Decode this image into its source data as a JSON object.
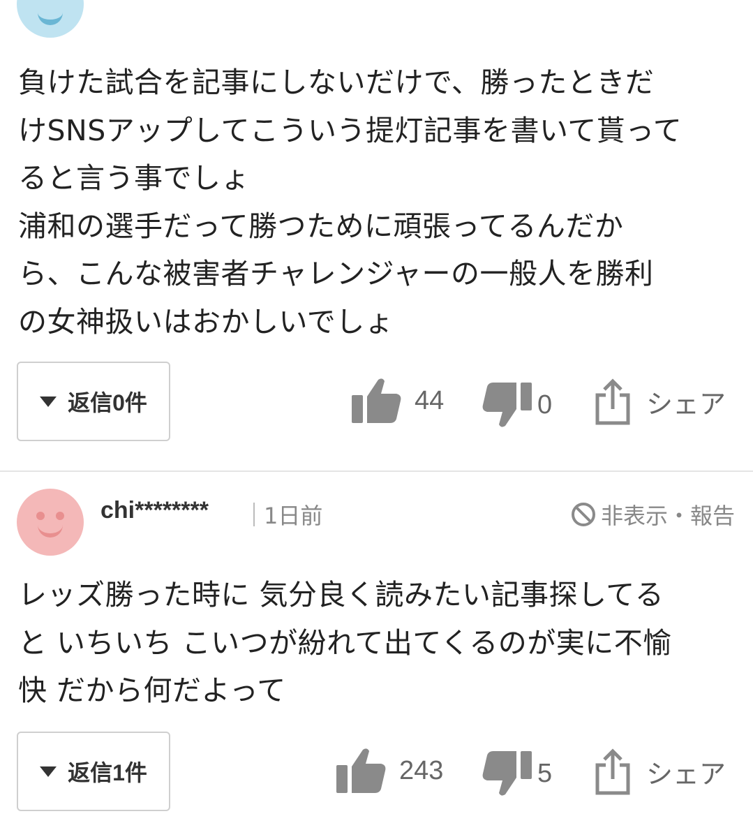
{
  "comment1": {
    "lines": [
      "負けた試合を記事にしないだけで、勝ったときだ",
      "けSNSアップしてこういう提灯記事を書いて貰って",
      "ると言う事でしょ",
      "浦和の選手だって勝つために頑張ってるんだか",
      "ら、こんな被害者チャレンジャーの一般人を勝利",
      "の女神扱いはおかしいでしょ"
    ],
    "reply_label": "返信0件",
    "likes": "44",
    "dislikes": "0",
    "share_label": "シェア"
  },
  "comment2": {
    "username": "chi********",
    "time": "1日前",
    "report_label": "非表示・報告",
    "lines": [
      "レッズ勝った時に 気分良く読みたい記事探してる",
      "と いちいち こいつが紛れて出てくるのが実に不愉",
      "快  だから何だよって"
    ],
    "reply_label": "返信1件",
    "likes": "243",
    "dislikes": "5",
    "share_label": "シェア"
  },
  "icons": {
    "like": "thumbs-up-icon",
    "dislike": "thumbs-down-icon",
    "share": "share-icon",
    "report": "block-icon",
    "expand": "triangle-down-icon"
  },
  "colors": {
    "icon_gray": "#8a8a8a",
    "avatar_pink": "#f4b8b8",
    "avatar_blue": "#bfe3f1"
  }
}
